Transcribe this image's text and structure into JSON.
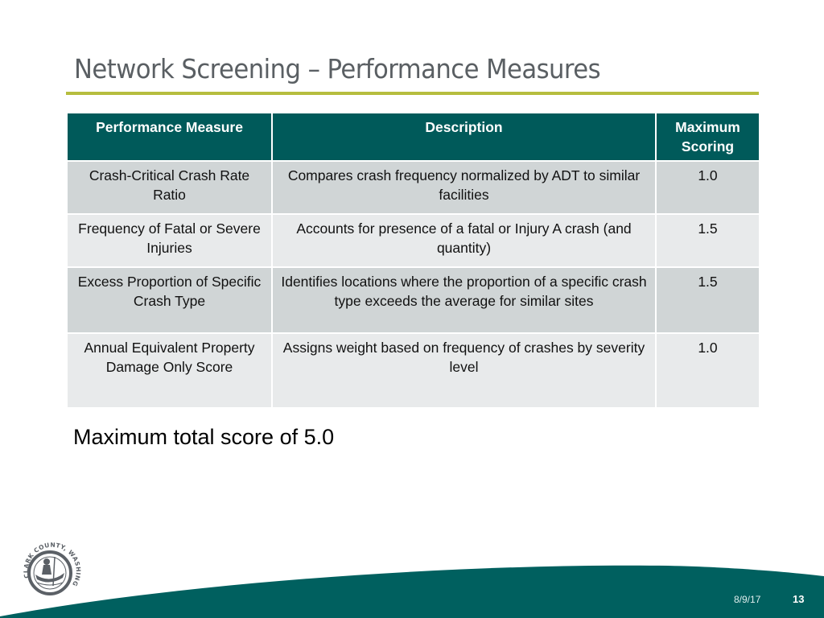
{
  "slide": {
    "title": "Network Screening – Performance Measures",
    "summary": "Maximum total score of 5.0",
    "footer": {
      "date": "8/9/17",
      "page_number": "13"
    },
    "logo_text": "CLARK COUNTY, WASHINGTON",
    "colors": {
      "header_bg": "#005a5a",
      "accent_rule": "#b6bd3e",
      "row_odd": "#d0d5d6",
      "row_even": "#e8eaeb",
      "footer_wave": "#00605f",
      "title_text": "#5a5f63"
    }
  },
  "table": {
    "headers": [
      "Performance Measure",
      "Description",
      "Maximum Scoring"
    ],
    "rows": [
      {
        "measure": "Crash-Critical Crash Rate Ratio",
        "description": "Compares crash frequency normalized by ADT to similar facilities",
        "score": "1.0"
      },
      {
        "measure": "Frequency of Fatal or Severe Injuries",
        "description": "Accounts for presence of a fatal or Injury A crash (and quantity)",
        "score": "1.5"
      },
      {
        "measure": "Excess Proportion of Specific Crash Type",
        "description": "Identifies locations where the proportion of  a specific crash type exceeds the average for similar sites",
        "score": "1.5"
      },
      {
        "measure": "Annual Equivalent Property Damage Only Score",
        "description": "Assigns weight based on frequency of crashes by severity level",
        "score": "1.0"
      }
    ]
  }
}
